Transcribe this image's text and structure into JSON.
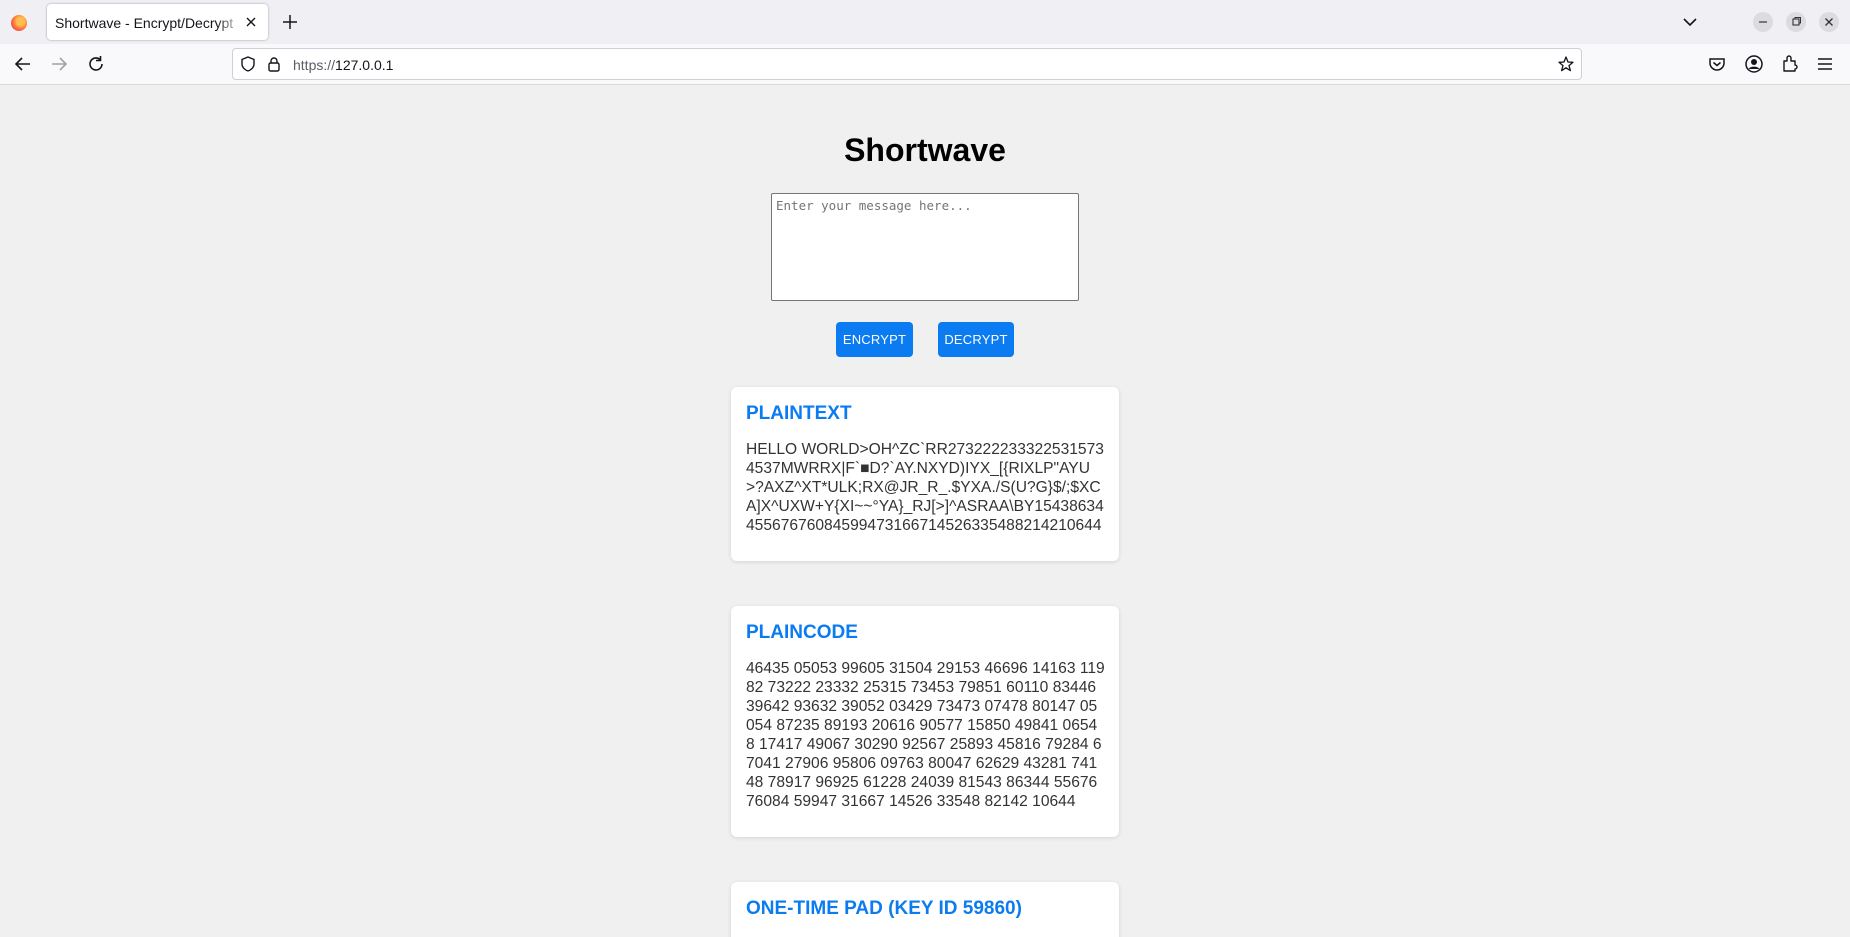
{
  "browser": {
    "tab_title": "Shortwave - Encrypt/Decrypt",
    "url_prefix": "https://",
    "url_host": "127.0.0.1"
  },
  "page": {
    "title": "Shortwave",
    "message_placeholder": "Enter your message here...",
    "encrypt_label": "ENCRYPT",
    "decrypt_label": "DECRYPT"
  },
  "cards": {
    "plaintext": {
      "heading": "PLAINTEXT",
      "body": "HELLO WORLD>OH^ZC`RR27322223332253157345​37MWRRX|F`■D?`AY.NXYD)IYX_[{RIXLP\"AYU>?AXZ^XT*ULK;RX@JR_R_.$YXA./S(U?G}$/;$XCA]X^UXW+Y{XI~~°YA}_RJ[>]^ASRAA\\BY154386344556767608459947316671452633548821421​0644"
    },
    "plaincode": {
      "heading": "PLAINCODE",
      "body": "46435 05053 99605 31504 29153 46696 14163 11982 73222 23332 25315 73453 79851 60110 83446 39642 93632 39052 03429 73473 07478 80147 05054 87235 89193 20616 90577 15850 49841 06548 17417 49067 30290 92567 25893 45816 79284 67041 27906 95806 09763 80047 62629 43281 74148 78917 96925 61228 24039 81543 86344 55676 76084 59947 31667 14526 33548 82142 10644"
    },
    "pad": {
      "heading": "ONE-TIME PAD (KEY ID 59860)"
    }
  }
}
